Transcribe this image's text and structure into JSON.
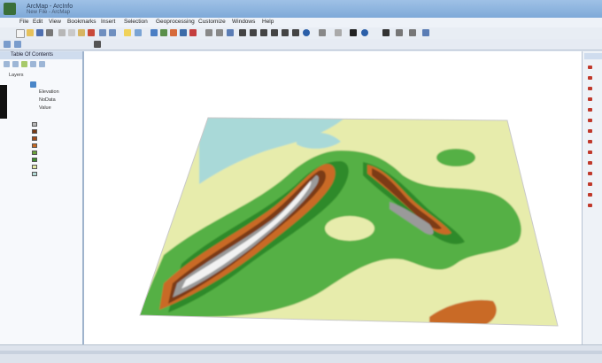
{
  "window": {
    "title": "ArcMap - ArcInfo",
    "subtitle": "New File - ArcMap",
    "colors": {
      "title_bar": "#8fb5df",
      "map_bg": "#ffffff"
    }
  },
  "menu": {
    "items": [
      "File",
      "Edit",
      "View",
      "Bookmarks",
      "Insert",
      "Selection",
      "Geoprocessing",
      "Customize",
      "Windows",
      "Help"
    ]
  },
  "toolbar": {
    "icons": [
      "new-icon",
      "open-icon",
      "save-icon",
      "print-icon",
      "cut-icon",
      "copy-icon",
      "paste-icon",
      "delete-icon",
      "undo-icon",
      "redo-icon",
      "add-data-icon",
      "scale-icon",
      "editor-icon",
      "table-icon",
      "catalog-icon",
      "search-icon",
      "python-icon",
      "model-icon"
    ],
    "scale_value": "",
    "tools_icons": [
      "zoom-in-icon",
      "zoom-out-icon",
      "fixed-zoom-in-icon",
      "fixed-zoom-out-icon",
      "pan-icon",
      "full-extent-icon",
      "back-icon",
      "forward-icon",
      "select-icon",
      "identify-icon",
      "find-icon",
      "measure-icon",
      "hyperlink-icon",
      "html-popup-icon",
      "time-slider-icon"
    ]
  },
  "toc": {
    "title": "Table Of Contents",
    "tree": [
      "Layers",
      "Elevation",
      "NoData",
      "Value"
    ],
    "legend_colors": [
      "#b7b7b7",
      "#7a3a14",
      "#a24a18",
      "#c86a24",
      "#6aa33a",
      "#3e8f2e",
      "#e4eaa6",
      "#b5dcd8"
    ]
  },
  "map": {
    "description": "3D terrain elevation raster with hypsometric color ramp",
    "palette": {
      "water": "#a9d9d8",
      "lowland": "#e7ecac",
      "green_light": "#55b044",
      "green_dark": "#2f8a2a",
      "brown_light": "#c96a26",
      "brown_dark": "#7b3a12",
      "gray": "#9a9a9a",
      "snow": "#f2f2f2"
    }
  },
  "right_panel": {
    "title": "",
    "item_count": 14
  },
  "status": {
    "text": ""
  }
}
